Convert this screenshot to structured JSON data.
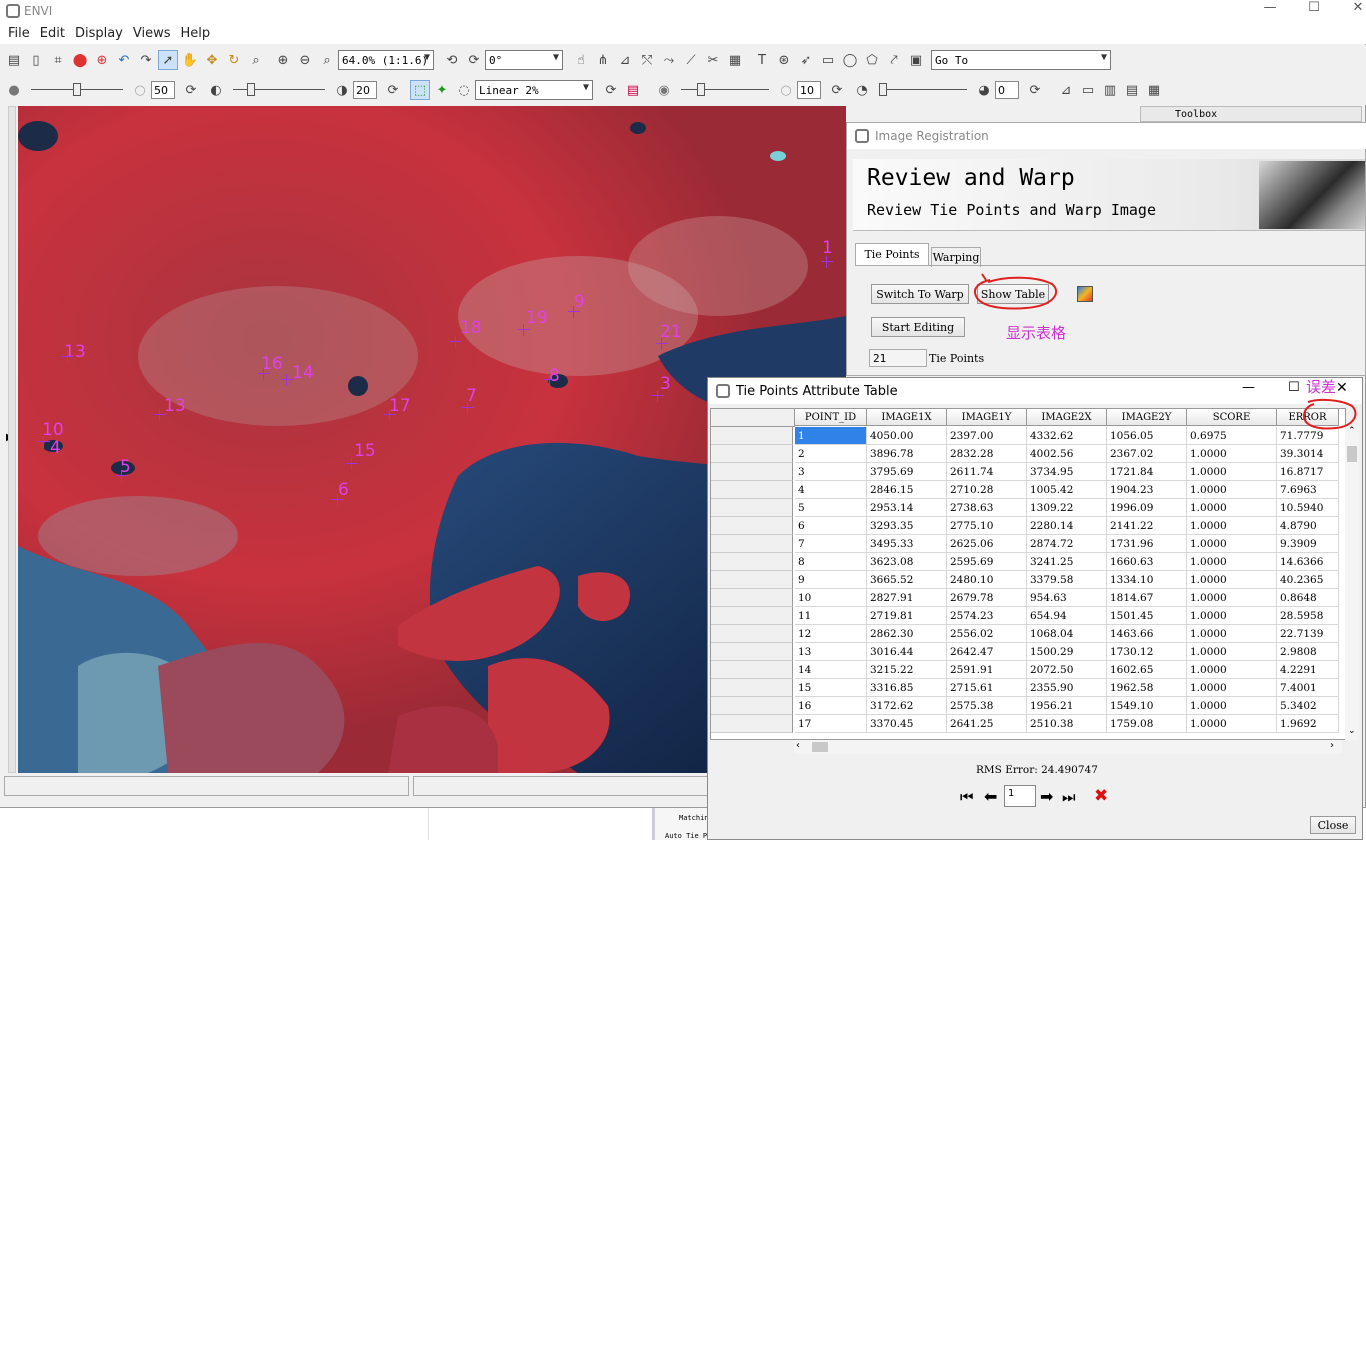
{
  "app": {
    "title": "ENVI"
  },
  "menu": [
    "File",
    "Edit",
    "Display",
    "Views",
    "Help"
  ],
  "toolbar1": {
    "zoom": "64.0% (1:1.6)",
    "rotation": "0°",
    "goto": "Go To"
  },
  "toolbar2": {
    "brightness": "50",
    "contrast": "20",
    "stretch": "Linear 2%",
    "sharpen": "10",
    "transparency": "0"
  },
  "map_labels": [
    {
      "id": "1"
    },
    {
      "id": "2"
    },
    {
      "id": "3"
    },
    {
      "id": "4"
    },
    {
      "id": "5"
    },
    {
      "id": "6"
    },
    {
      "id": "7"
    },
    {
      "id": "8"
    },
    {
      "id": "9"
    },
    {
      "id": "10"
    },
    {
      "id": "12"
    },
    {
      "id": "13"
    },
    {
      "id": "14"
    },
    {
      "id": "15"
    },
    {
      "id": "16"
    },
    {
      "id": "17"
    },
    {
      "id": "18"
    },
    {
      "id": "19"
    },
    {
      "id": "21"
    }
  ],
  "toolbox": {
    "label": "Toolbox",
    "items": [
      "Matchin",
      "Auto Tie P"
    ]
  },
  "registration": {
    "window_title": "Image Registration",
    "header_title": "Review and Warp",
    "header_subtitle": "Review Tie Points and Warp Image",
    "tabs": [
      "Tie Points",
      "Warping"
    ],
    "switch_button": "Switch To Warp",
    "show_table_button": "Show Table",
    "start_editing_button": "Start Editing",
    "tie_point_count": "21",
    "tie_points_label": "Tie Points"
  },
  "annotations": {
    "show_table_note": "显示表格",
    "error_note": "误差"
  },
  "table_window": {
    "title": "Tie Points Attribute Table",
    "columns": [
      "POINT_ID",
      "IMAGE1X",
      "IMAGE1Y",
      "IMAGE2X",
      "IMAGE2Y",
      "SCORE",
      "ERROR"
    ],
    "rows": [
      [
        "1",
        "4050.00",
        "2397.00",
        "4332.62",
        "1056.05",
        "0.6975",
        "71.7779"
      ],
      [
        "2",
        "3896.78",
        "2832.28",
        "4002.56",
        "2367.02",
        "1.0000",
        "39.3014"
      ],
      [
        "3",
        "3795.69",
        "2611.74",
        "3734.95",
        "1721.84",
        "1.0000",
        "16.8717"
      ],
      [
        "4",
        "2846.15",
        "2710.28",
        "1005.42",
        "1904.23",
        "1.0000",
        "7.6963"
      ],
      [
        "5",
        "2953.14",
        "2738.63",
        "1309.22",
        "1996.09",
        "1.0000",
        "10.5940"
      ],
      [
        "6",
        "3293.35",
        "2775.10",
        "2280.14",
        "2141.22",
        "1.0000",
        "4.8790"
      ],
      [
        "7",
        "3495.33",
        "2625.06",
        "2874.72",
        "1731.96",
        "1.0000",
        "9.3909"
      ],
      [
        "8",
        "3623.08",
        "2595.69",
        "3241.25",
        "1660.63",
        "1.0000",
        "14.6366"
      ],
      [
        "9",
        "3665.52",
        "2480.10",
        "3379.58",
        "1334.10",
        "1.0000",
        "40.2365"
      ],
      [
        "10",
        "2827.91",
        "2679.78",
        "954.63",
        "1814.67",
        "1.0000",
        "0.8648"
      ],
      [
        "11",
        "2719.81",
        "2574.23",
        "654.94",
        "1501.45",
        "1.0000",
        "28.5958"
      ],
      [
        "12",
        "2862.30",
        "2556.02",
        "1068.04",
        "1463.66",
        "1.0000",
        "22.7139"
      ],
      [
        "13",
        "3016.44",
        "2642.47",
        "1500.29",
        "1730.12",
        "1.0000",
        "2.9808"
      ],
      [
        "14",
        "3215.22",
        "2591.91",
        "2072.50",
        "1602.65",
        "1.0000",
        "4.2291"
      ],
      [
        "15",
        "3316.85",
        "2715.61",
        "2355.90",
        "1962.58",
        "1.0000",
        "7.4001"
      ],
      [
        "16",
        "3172.62",
        "2575.38",
        "1956.21",
        "1549.10",
        "1.0000",
        "5.3402"
      ],
      [
        "17",
        "3370.45",
        "2641.25",
        "2510.38",
        "1759.08",
        "1.0000",
        "1.9692"
      ]
    ],
    "rms_error": "RMS Error: 24.490747",
    "current_point": "1",
    "close_button": "Close"
  }
}
